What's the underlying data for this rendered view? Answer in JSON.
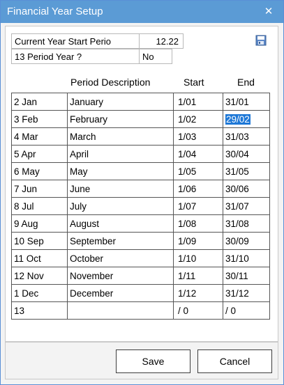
{
  "window": {
    "title": "Financial Year Setup",
    "close_glyph": "✕"
  },
  "settings": {
    "start_label": "Current Year Start Perio",
    "start_value": "12.22",
    "period13_label": "13 Period Year ?",
    "period13_value": "No"
  },
  "icons": {
    "save": "save-disk-icon"
  },
  "grid": {
    "headers": {
      "description": "Period Description",
      "start": "Start",
      "end": "End"
    },
    "rows": [
      {
        "period": "2 Jan",
        "description": "January",
        "start": "1/01",
        "end": "31/01"
      },
      {
        "period": "3 Feb",
        "description": "February",
        "start": "1/02",
        "end": "29/02"
      },
      {
        "period": "4 Mar",
        "description": "March",
        "start": "1/03",
        "end": "31/03"
      },
      {
        "period": "5 Apr",
        "description": "April",
        "start": "1/04",
        "end": "30/04"
      },
      {
        "period": "6 May",
        "description": "May",
        "start": "1/05",
        "end": "31/05"
      },
      {
        "period": "7 Jun",
        "description": "June",
        "start": "1/06",
        "end": "30/06"
      },
      {
        "period": "8 Jul",
        "description": "July",
        "start": "1/07",
        "end": "31/07"
      },
      {
        "period": "9 Aug",
        "description": "August",
        "start": "1/08",
        "end": "31/08"
      },
      {
        "period": "10 Sep",
        "description": "September",
        "start": "1/09",
        "end": "30/09"
      },
      {
        "period": "11 Oct",
        "description": "October",
        "start": "1/10",
        "end": "31/10"
      },
      {
        "period": "12 Nov",
        "description": "November",
        "start": "1/11",
        "end": "30/11"
      },
      {
        "period": "1 Dec",
        "description": "December",
        "start": "1/12",
        "end": "31/12"
      },
      {
        "period": "13",
        "description": "",
        "start": "/ 0",
        "end": "/ 0"
      }
    ]
  },
  "buttons": {
    "save": "Save",
    "cancel": "Cancel"
  },
  "colors": {
    "titlebar": "#5b9bd5",
    "selection": "#1e78d7"
  }
}
